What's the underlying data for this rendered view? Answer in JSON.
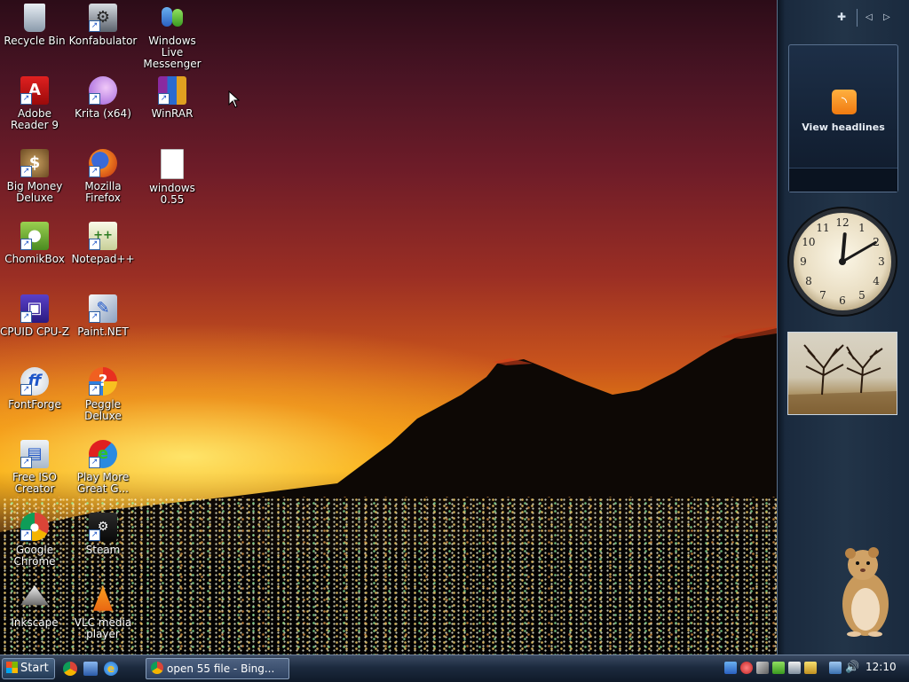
{
  "desktop": {
    "icons": [
      {
        "label": "Recycle Bin",
        "icon": "recycle-bin-icon"
      },
      {
        "label": "Konfabulator",
        "icon": "konfabulator-icon"
      },
      {
        "label": "Windows Live Messenger",
        "icon": "messenger-icon"
      },
      {
        "label": "Adobe Reader 9",
        "icon": "adobe-reader-icon"
      },
      {
        "label": "Krita (x64)",
        "icon": "krita-icon"
      },
      {
        "label": "WinRAR",
        "icon": "winrar-icon"
      },
      {
        "label": "Big Money Deluxe",
        "icon": "big-money-icon"
      },
      {
        "label": "Mozilla Firefox",
        "icon": "firefox-icon"
      },
      {
        "label": "windows 0.55",
        "icon": "file-icon"
      },
      {
        "label": "ChomikBox",
        "icon": "chomikbox-icon"
      },
      {
        "label": "Notepad++",
        "icon": "notepadpp-icon"
      },
      {
        "label": "CPUID CPU-Z",
        "icon": "cpuz-icon"
      },
      {
        "label": "Paint.NET",
        "icon": "paintnet-icon"
      },
      {
        "label": "FontForge",
        "icon": "fontforge-icon"
      },
      {
        "label": "Peggle Deluxe",
        "icon": "peggle-icon"
      },
      {
        "label": "Free ISO Creator",
        "icon": "iso-creator-icon"
      },
      {
        "label": "Play More Great G...",
        "icon": "games-icon"
      },
      {
        "label": "Google Chrome",
        "icon": "chrome-icon"
      },
      {
        "label": "Steam",
        "icon": "steam-icon"
      },
      {
        "label": "Inkscape",
        "icon": "inkscape-icon"
      },
      {
        "label": "VLC media player",
        "icon": "vlc-icon"
      }
    ]
  },
  "sidebar": {
    "add_glyph": "✚",
    "prev_glyph": "◁",
    "next_glyph": "▷",
    "feed_title": "View headlines",
    "clock_numbers": [
      "12",
      "1",
      "2",
      "3",
      "4",
      "5",
      "6",
      "7",
      "8",
      "9",
      "10",
      "11"
    ]
  },
  "taskbar": {
    "start_label": "Start",
    "task_label": "open 55 file - Bing...",
    "clock": "12:10"
  },
  "colors": {
    "taskbar": "#1c2a3e",
    "sidebar": "#223448",
    "sunset_glow": "#f4b20e"
  }
}
